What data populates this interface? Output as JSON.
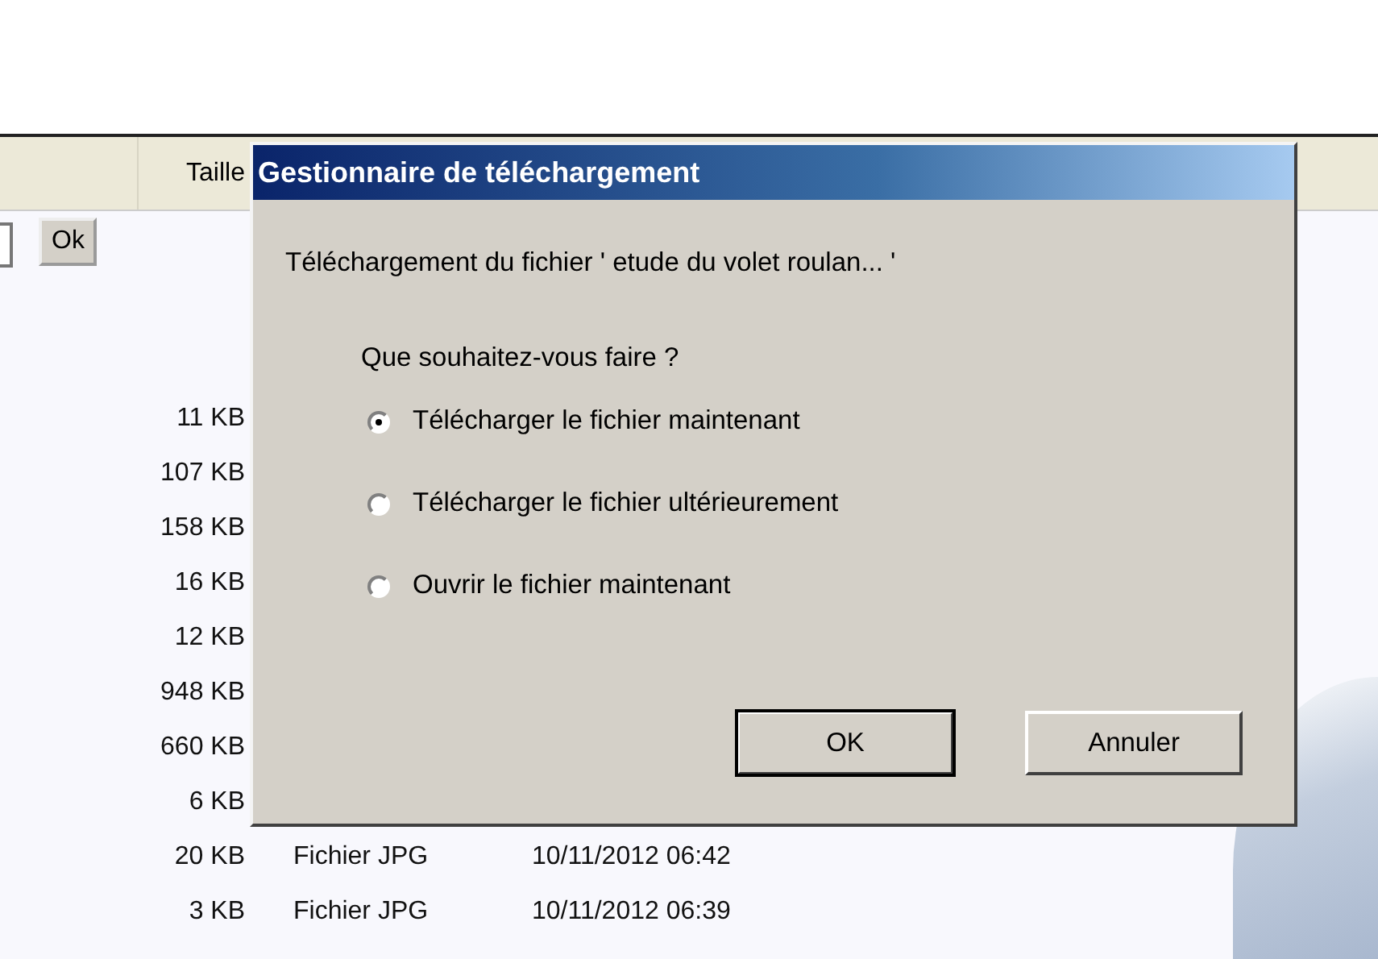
{
  "background": {
    "columns": [
      {
        "label": "Taille"
      }
    ],
    "ok_button": "Ok",
    "rows": [
      {
        "size": "11 KB"
      },
      {
        "size": "107 KB"
      },
      {
        "size": "158 KB"
      },
      {
        "size": "16 KB"
      },
      {
        "size": "12 KB"
      },
      {
        "size": "948 KB"
      },
      {
        "size": "660 KB"
      },
      {
        "size": "6 KB"
      },
      {
        "size": "20 KB",
        "type": "Fichier JPG",
        "date": "10/11/2012 06:42"
      },
      {
        "size": "3 KB",
        "type": "Fichier JPG",
        "date": "10/11/2012 06:39"
      }
    ]
  },
  "dialog": {
    "title": "Gestionnaire de téléchargement",
    "message": "Téléchargement du fichier ' etude du volet roulan... '",
    "question": "Que souhaitez-vous faire ?",
    "options": [
      {
        "label": "Télécharger le fichier maintenant",
        "selected": true
      },
      {
        "label": "Télécharger le fichier ultérieurement",
        "selected": false
      },
      {
        "label": "Ouvrir le fichier maintenant",
        "selected": false
      }
    ],
    "buttons": [
      {
        "label": "OK",
        "default": true
      },
      {
        "label": "Annuler",
        "default": false
      }
    ]
  }
}
